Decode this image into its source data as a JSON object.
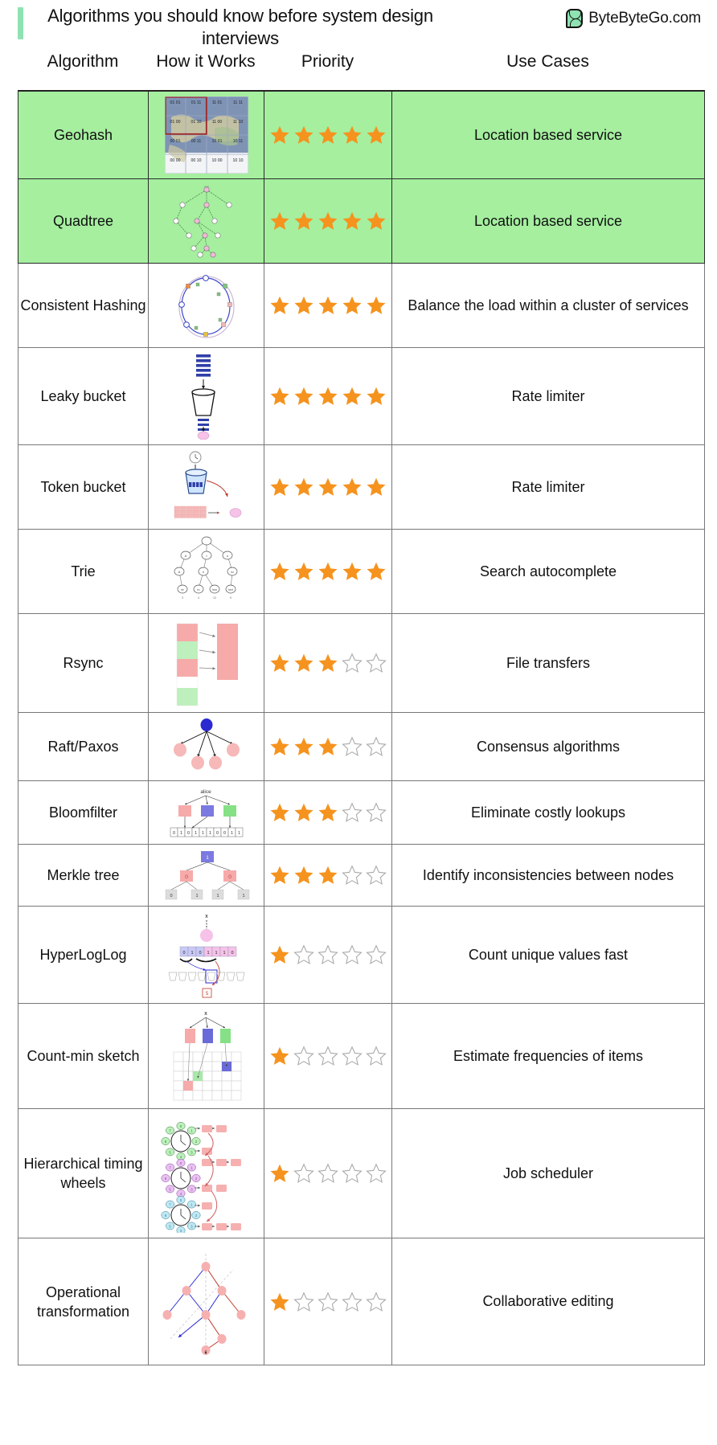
{
  "header": {
    "title": "Algorithms you should know before system design interviews",
    "brand_name": "ByteByteGo.com",
    "accent_color": "#8fe3b2"
  },
  "table": {
    "columns": [
      "Algorithm",
      "How it Works",
      "Priority",
      "Use Cases"
    ],
    "max_stars": 5,
    "star_filled_color": "#F5931E",
    "star_empty_color": "#ffffff",
    "highlight_color": "#a5ef9f",
    "rows": [
      {
        "algorithm": "Geohash",
        "figure": "geohash-grid-map-figure",
        "priority": 5,
        "use_case": "Location based service",
        "highlighted": true
      },
      {
        "algorithm": "Quadtree",
        "figure": "quadtree-tree-figure",
        "priority": 5,
        "use_case": "Location based service",
        "highlighted": true
      },
      {
        "algorithm": "Consistent Hashing",
        "figure": "consistent-hashing-ring-figure",
        "priority": 5,
        "use_case": "Balance the load within a cluster of services",
        "highlighted": false
      },
      {
        "algorithm": "Leaky bucket",
        "figure": "leaky-bucket-figure",
        "priority": 5,
        "use_case": "Rate limiter",
        "highlighted": false
      },
      {
        "algorithm": "Token bucket",
        "figure": "token-bucket-figure",
        "priority": 5,
        "use_case": "Rate limiter",
        "highlighted": false
      },
      {
        "algorithm": "Trie",
        "figure": "trie-tree-figure",
        "priority": 5,
        "use_case": "Search autocomplete",
        "highlighted": false
      },
      {
        "algorithm": "Rsync",
        "figure": "rsync-block-diff-figure",
        "priority": 3,
        "use_case": "File transfers",
        "highlighted": false
      },
      {
        "algorithm": "Raft/Paxos",
        "figure": "raft-paxos-leader-figure",
        "priority": 3,
        "use_case": "Consensus algorithms",
        "highlighted": false
      },
      {
        "algorithm": "Bloomfilter",
        "figure": "bloomfilter-bitarray-figure",
        "priority": 3,
        "use_case": "Eliminate costly lookups",
        "highlighted": false
      },
      {
        "algorithm": "Merkle tree",
        "figure": "merkle-tree-figure",
        "priority": 3,
        "use_case": "Identify inconsistencies between nodes",
        "highlighted": false
      },
      {
        "algorithm": "HyperLogLog",
        "figure": "hyperloglog-figure",
        "priority": 1,
        "use_case": "Count unique values fast",
        "highlighted": false
      },
      {
        "algorithm": "Count-min sketch",
        "figure": "count-min-sketch-figure",
        "priority": 1,
        "use_case": "Estimate frequencies of items",
        "highlighted": false
      },
      {
        "algorithm": "Hierarchical timing wheels",
        "figure": "timing-wheels-figure",
        "priority": 1,
        "use_case": "Job scheduler",
        "highlighted": false
      },
      {
        "algorithm": "Operational transformation",
        "figure": "operational-transformation-figure",
        "priority": 1,
        "use_case": "Collaborative editing",
        "highlighted": false
      }
    ]
  },
  "figure_labels": {
    "geohash_cells": [
      [
        "01 01",
        "01 11",
        "11 01",
        "11 11"
      ],
      [
        "01 00",
        "01 10",
        "11 00",
        "11 10"
      ],
      [
        "00 01",
        "00 11",
        "10 01",
        "10 11"
      ],
      [
        "00 00",
        "00 10",
        "10 00",
        "10 10"
      ]
    ],
    "bloomfilter_key": "alice",
    "bloomfilter_bits": [
      "0",
      "1",
      "0",
      "1",
      "1",
      "1",
      "0",
      "0",
      "1",
      "1"
    ],
    "hyperloglog_input": "x",
    "hyperloglog_bits": [
      "0",
      "1",
      "0",
      "1",
      "1",
      "1",
      "0"
    ],
    "hyperloglog_register": "5",
    "countmin_input": "x",
    "merkle_root": "1",
    "merkle_mid": [
      "0",
      "0"
    ],
    "merkle_leaves": [
      "0",
      "1",
      "1",
      "1"
    ],
    "timing_wheel_slots": [
      "0",
      "1",
      "2",
      "3",
      "4",
      "5",
      "6",
      "7"
    ]
  }
}
